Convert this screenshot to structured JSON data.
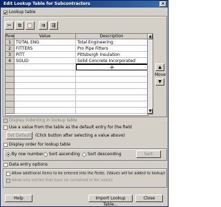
{
  "window": {
    "title": "Edit Lookup Table for Subcontractors",
    "close_glyph": "×"
  },
  "lookup_table": {
    "toggle_label": "Lookup table",
    "toolbar": {
      "icons": [
        "cut-icon",
        "copy-icon",
        "paste-icon",
        "insert-row-icon",
        "delete-row-icon"
      ]
    },
    "columns": {
      "row": "Row",
      "value": "Value",
      "description": "Description"
    },
    "rows": [
      {
        "num": "1",
        "value": "TOTAL ENG",
        "description": "Total Engineering"
      },
      {
        "num": "2",
        "value": "FITTERS",
        "description": "Pro Pipe Fitters"
      },
      {
        "num": "3",
        "value": "PITT",
        "description": "Pittsburgh Insulation"
      },
      {
        "num": "4",
        "value": "SOLID",
        "description": "Solid Concrete Incorporated"
      }
    ],
    "move_label": "Move"
  },
  "options": {
    "display_indenting": "Display indenting in lookup table",
    "use_default": "Use a value from the table as the default entry for the field",
    "set_default": "Set Default",
    "set_default_hint": "(Click button after selecting a value above)"
  },
  "display_order": {
    "toggle_label": "Display order for lookup table",
    "by_row": "By row number",
    "ascending": "Sort ascending",
    "descending": "Sort descending",
    "sort_button": "Sort"
  },
  "data_entry": {
    "toggle_label": "Data entry options",
    "allow_additional": "Allow additional items to be entered into the fields. (Values will be added to lookup)",
    "allow_not_contained": "Allow only entries that have no contained in the values"
  },
  "buttons": {
    "help": "Help",
    "import": "Import Lookup Table...",
    "close": "Close"
  }
}
